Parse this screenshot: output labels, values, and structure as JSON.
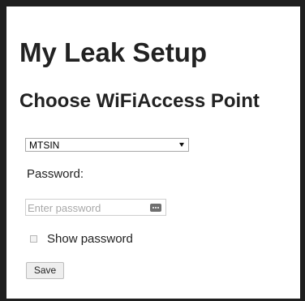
{
  "page": {
    "title": "My Leak Setup",
    "subtitle": "Choose WiFiAccess Point"
  },
  "wifi": {
    "selected_network": "MTSIN"
  },
  "password": {
    "label": "Password:",
    "placeholder": "Enter password",
    "icon": "password-manager-icon"
  },
  "options": {
    "show_password_label": "Show password",
    "show_password_checked": false
  },
  "actions": {
    "save_label": "Save"
  }
}
